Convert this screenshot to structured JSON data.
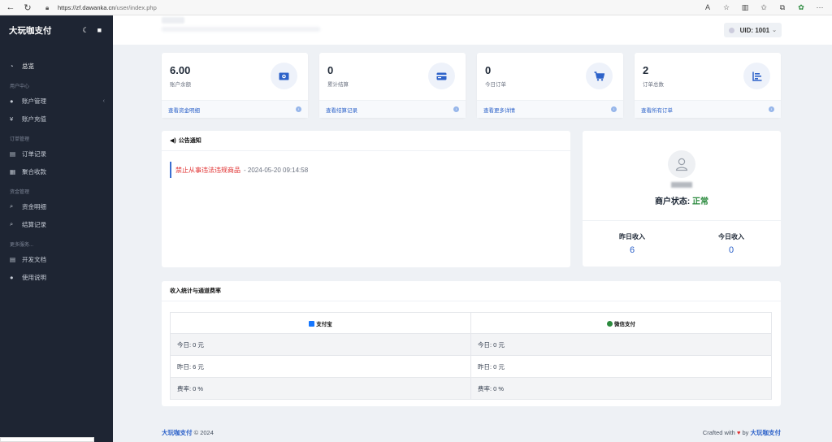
{
  "browser": {
    "url_host": "https://zf.dawanka.cn",
    "url_path": "/user/index.php"
  },
  "sidebar": {
    "brand": "大玩咖支付",
    "items": [
      {
        "type": "item",
        "label": "总览",
        "icon": "gauge-icon",
        "active": true
      },
      {
        "type": "section",
        "label": "用户中心"
      },
      {
        "type": "item",
        "label": "账户管理",
        "icon": "user-icon",
        "chevron": true
      },
      {
        "type": "item",
        "label": "账户充值",
        "icon": "yen-icon"
      },
      {
        "type": "section",
        "label": "订单管理"
      },
      {
        "type": "item",
        "label": "订单记录",
        "icon": "cart-icon"
      },
      {
        "type": "item",
        "label": "聚合收款",
        "icon": "grid-icon"
      },
      {
        "type": "section",
        "label": "资金管理"
      },
      {
        "type": "item",
        "label": "资金明细",
        "icon": "search-icon"
      },
      {
        "type": "item",
        "label": "结算记录",
        "icon": "search-icon"
      },
      {
        "type": "section",
        "label": "更多服务..."
      },
      {
        "type": "item",
        "label": "开发文档",
        "icon": "doc-icon"
      },
      {
        "type": "item",
        "label": "使用说明",
        "icon": "help-icon"
      }
    ]
  },
  "header": {
    "uid": "UID: 1001"
  },
  "stats": [
    {
      "value": "6.00",
      "label": "账户余额",
      "link": "查看资金明细",
      "icon": "money-icon"
    },
    {
      "value": "0",
      "label": "累计结算",
      "link": "查看结算记录",
      "icon": "card-icon"
    },
    {
      "value": "0",
      "label": "今日订单",
      "link": "查看更多详情",
      "icon": "cart-icon"
    },
    {
      "value": "2",
      "label": "订单总数",
      "link": "查看所有订单",
      "icon": "chart-icon"
    }
  ],
  "notice": {
    "title": "公告通知",
    "item_text": "禁止从事违法违规商品",
    "item_date": "- 2024-05-20 09:14:58"
  },
  "merchant": {
    "status_label": "商户状态: ",
    "status_value": "正常",
    "yesterday_label": "昨日收入",
    "yesterday_value": "6",
    "today_label": "今日收入",
    "today_value": "0"
  },
  "rates": {
    "title": "收入统计与通道费率",
    "alipay": "支付宝",
    "wechat": "微信支付",
    "rows": [
      [
        "今日: 0 元",
        "今日: 0 元"
      ],
      [
        "昨日: 6 元",
        "昨日: 0 元"
      ],
      [
        "费率: 0 %",
        "费率: 0 %"
      ]
    ]
  },
  "footer": {
    "brand": "大玩咖支付",
    "copyright": "© 2024",
    "crafted": "Crafted with",
    "by": "by",
    "brand2": "大玩咖支付"
  },
  "colors": {
    "sidebar": "#1e2533",
    "accent": "#2d62c9",
    "ok": "#2b8a3e",
    "danger": "#e03131"
  }
}
